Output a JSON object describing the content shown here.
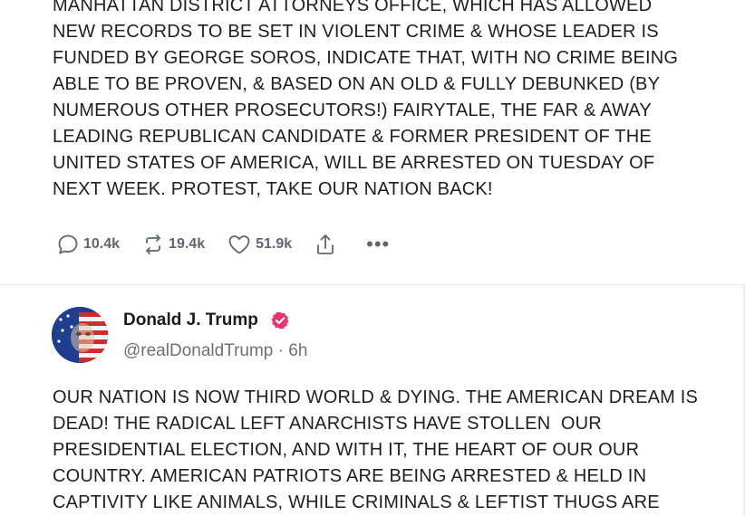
{
  "posts": [
    {
      "text_lines": [
        "MANHATTAN DISTRICT ATTORNEYS OFFICE, WHICH HAS ALLOWED",
        "NEW RECORDS TO BE SET IN VIOLENT CRIME & WHOSE LEADER IS",
        "FUNDED BY GEORGE SOROS, INDICATE THAT, WITH NO CRIME BEING",
        "ABLE TO BE PROVEN, & BASED ON AN OLD & FULLY DEBUNKED (BY",
        "NUMEROUS OTHER PROSECUTORS!) FAIRYTALE, THE FAR & AWAY",
        "LEADING REPUBLICAN CANDIDATE & FORMER PRESIDENT OF THE",
        "UNITED STATES OF AMERICA, WILL BE ARRESTED ON TUESDAY OF",
        "NEXT WEEK. PROTEST, TAKE OUR NATION BACK!"
      ],
      "actions": {
        "replies": "10.4k",
        "reposts": "19.4k",
        "likes": "51.9k"
      }
    },
    {
      "author": {
        "name": "Donald J. Trump",
        "handle": "@realDonaldTrump",
        "separator": "·",
        "time": "6h"
      },
      "text_lines": [
        "OUR NATION IS NOW THIRD WORLD & DYING. THE AMERICAN DREAM IS",
        "DEAD! THE RADICAL LEFT ANARCHISTS HAVE STOLLEN  OUR",
        "PRESIDENTIAL ELECTION, AND WITH IT, THE HEART OF OUR OUR",
        "COUNTRY. AMERICAN PATRIOTS ARE BEING ARRESTED & HELD IN",
        "CAPTIVITY LIKE ANIMALS, WHILE CRIMINALS & LEFTIST THUGS ARE"
      ]
    }
  ],
  "icons": {
    "reply": "reply-icon",
    "repost": "repost-icon",
    "like": "heart-icon",
    "share": "share-icon",
    "more": "more-icon",
    "verified": "verified-badge-icon"
  },
  "colors": {
    "text": "#1f1f1f",
    "muted": "#6b7178",
    "verified": "#e8336d"
  }
}
